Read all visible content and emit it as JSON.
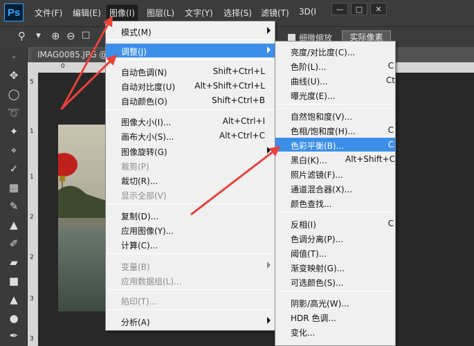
{
  "app": {
    "logo_text": "Ps"
  },
  "menubar": {
    "items": [
      "文件(F)",
      "编辑(E)",
      "图像(I)",
      "图层(L)",
      "文字(Y)",
      "选择(S)",
      "滤镜(T)",
      "3D(I"
    ],
    "active": "图像(I)"
  },
  "options": {
    "scrubby_zoom_label": "细微缩放",
    "actual_pixels_label": "实际像素"
  },
  "document": {
    "tab_title": "IMAG0085.JPG @"
  },
  "ruler": {
    "top": [
      "0",
      "50",
      "1"
    ],
    "left": [
      "5",
      "1",
      "1",
      "2",
      "2",
      "3",
      "3"
    ]
  },
  "image_menu": {
    "items": [
      {
        "label": "模式(M)",
        "submenu": true
      },
      {
        "label": "调整(J)",
        "submenu": true,
        "highlighted": true
      },
      {
        "label": "自动色调(N)",
        "shortcut": "Shift+Ctrl+L"
      },
      {
        "label": "自动对比度(U)",
        "shortcut": "Alt+Shift+Ctrl+L"
      },
      {
        "label": "自动颜色(O)",
        "shortcut": "Shift+Ctrl+B"
      },
      {
        "label": "图像大小(I)...",
        "shortcut": "Alt+Ctrl+I"
      },
      {
        "label": "画布大小(S)...",
        "shortcut": "Alt+Ctrl+C"
      },
      {
        "label": "图像旋转(G)",
        "submenu": true
      },
      {
        "label": "裁剪(P)",
        "disabled": true
      },
      {
        "label": "裁切(R)..."
      },
      {
        "label": "显示全部(V)",
        "disabled": true
      },
      {
        "label": "复制(D)..."
      },
      {
        "label": "应用图像(Y)..."
      },
      {
        "label": "计算(C)..."
      },
      {
        "label": "变量(B)",
        "submenu": true,
        "disabled": true
      },
      {
        "label": "应用数据组(L)...",
        "disabled": true
      },
      {
        "label": "陷印(T)...",
        "disabled": true
      },
      {
        "label": "分析(A)",
        "submenu": true
      }
    ]
  },
  "adjust_menu": {
    "items": [
      {
        "label": "亮度/对比度(C)..."
      },
      {
        "label": "色阶(L)...",
        "shortcut": "C"
      },
      {
        "label": "曲线(U)...",
        "shortcut": "Ct"
      },
      {
        "label": "曝光度(E)..."
      },
      {
        "label": "自然饱和度(V)..."
      },
      {
        "label": "色相/饱和度(H)...",
        "shortcut": "C"
      },
      {
        "label": "色彩平衡(B)...",
        "shortcut": "C",
        "highlighted": true
      },
      {
        "label": "黑白(K)...",
        "shortcut": "Alt+Shift+C"
      },
      {
        "label": "照片滤镜(F)..."
      },
      {
        "label": "通道混合器(X)..."
      },
      {
        "label": "颜色查找..."
      },
      {
        "label": "反相(I)",
        "shortcut": "C"
      },
      {
        "label": "色调分离(P)..."
      },
      {
        "label": "阈值(T)..."
      },
      {
        "label": "渐变映射(G)..."
      },
      {
        "label": "可选颜色(S)..."
      },
      {
        "label": "阴影/高光(W)..."
      },
      {
        "label": "HDR 色调..."
      },
      {
        "label": "变化..."
      }
    ]
  },
  "colors": {
    "highlight": "#3c8fe8",
    "arrow": "#e8423a",
    "menubar": "#3c3c3c",
    "menu_bg": "#f0f0f0"
  }
}
